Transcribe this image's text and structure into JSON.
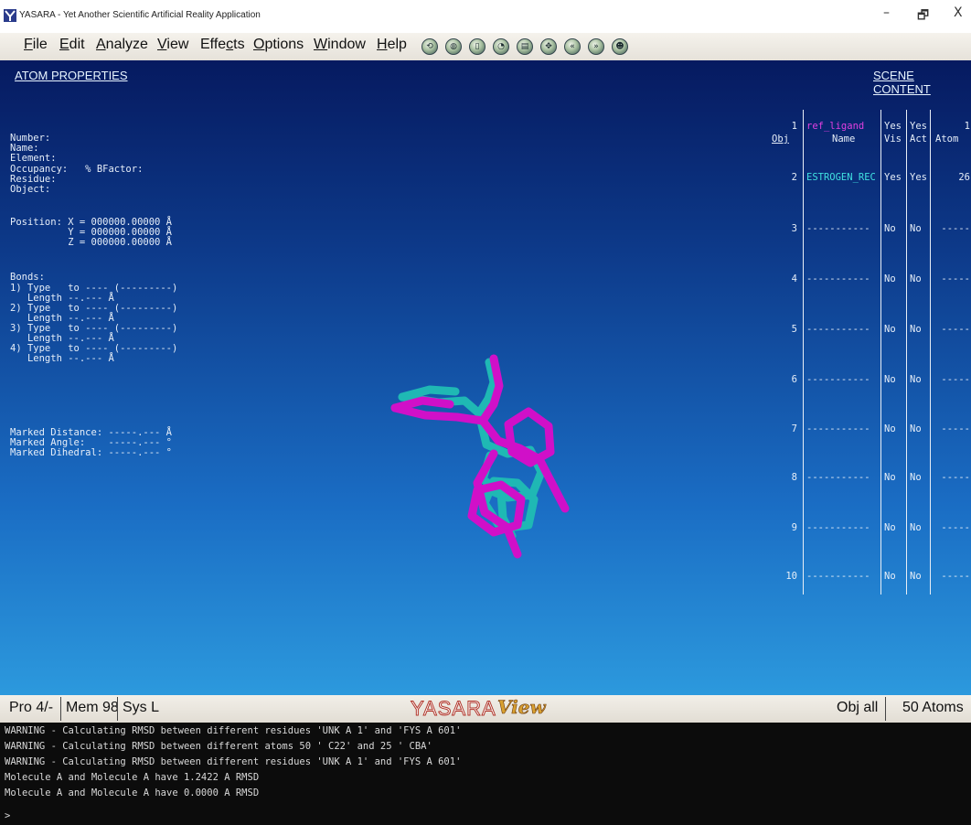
{
  "window": {
    "title": "YASARA - Yet Another Scientific Artificial Reality Application",
    "minimize": "–",
    "maximize": "🗗",
    "close": "X"
  },
  "menu": {
    "items": [
      "File",
      "Edit",
      "Analyze",
      "View",
      "Effects",
      "Options",
      "Window",
      "Help"
    ],
    "accelerators": [
      "F",
      "E",
      "A",
      "V",
      "c",
      "O",
      "W",
      "H"
    ],
    "toolbar_icons": [
      "reset-icon",
      "globe-icon",
      "page-icon",
      "gauge-icon",
      "lock-icon",
      "move-icon",
      "rewind-icon",
      "forward-icon",
      "user-icon"
    ]
  },
  "atom_properties": {
    "header": "ATOM PROPERTIES",
    "number_label": "Number:",
    "name_label": "Name:",
    "element_label": "Element:",
    "occupancy_label": "Occupancy:   % BFactor:",
    "residue_label": "Residue:",
    "object_label": "Object:",
    "position_x": "Position: X = 000000.00000 Å",
    "position_y": "          Y = 000000.00000 Å",
    "position_z": "          Z = 000000.00000 Å",
    "bonds_label": "Bonds:",
    "bonds": [
      {
        "type": "1) Type   to ---- (---------)",
        "length": "   Length --.--- Å"
      },
      {
        "type": "2) Type   to ---- (---------)",
        "length": "   Length --.--- Å"
      },
      {
        "type": "3) Type   to ---- (---------)",
        "length": "   Length --.--- Å"
      },
      {
        "type": "4) Type   to ---- (---------)",
        "length": "   Length --.--- Å"
      }
    ],
    "marked_distance": "Marked Distance: -----.--- Å",
    "marked_angle": "Marked Angle:    -----.--- °",
    "marked_dihedral": "Marked Dihedral: -----.--- °"
  },
  "scene_content": {
    "header": "SCENE CONTENT",
    "columns": [
      "Obj",
      "Name",
      "Vis",
      "Act",
      "Atom"
    ],
    "rows": [
      {
        "obj": "1",
        "name": "ref_ligand",
        "vis": "Yes",
        "act": "Yes",
        "atom": "1",
        "name_color": "#e040e0"
      },
      {
        "obj": "2",
        "name": "ESTROGEN_REC",
        "vis": "Yes",
        "act": "Yes",
        "atom": "26",
        "name_color": "#40e0e0"
      },
      {
        "obj": "3",
        "name": "-----------",
        "vis": "No",
        "act": "No",
        "atom": "-----",
        "name_color": "#e6eef8"
      },
      {
        "obj": "4",
        "name": "-----------",
        "vis": "No",
        "act": "No",
        "atom": "-----",
        "name_color": "#e6eef8"
      },
      {
        "obj": "5",
        "name": "-----------",
        "vis": "No",
        "act": "No",
        "atom": "-----",
        "name_color": "#e6eef8"
      },
      {
        "obj": "6",
        "name": "-----------",
        "vis": "No",
        "act": "No",
        "atom": "-----",
        "name_color": "#e6eef8"
      },
      {
        "obj": "7",
        "name": "-----------",
        "vis": "No",
        "act": "No",
        "atom": "-----",
        "name_color": "#e6eef8"
      },
      {
        "obj": "8",
        "name": "-----------",
        "vis": "No",
        "act": "No",
        "atom": "-----",
        "name_color": "#e6eef8"
      },
      {
        "obj": "9",
        "name": "-----------",
        "vis": "No",
        "act": "No",
        "atom": "-----",
        "name_color": "#e6eef8"
      },
      {
        "obj": "10",
        "name": "-----------",
        "vis": "No",
        "act": "No",
        "atom": "-----",
        "name_color": "#e6eef8"
      }
    ]
  },
  "statusbar": {
    "pro": "Pro 4/-",
    "mem": "Mem 98",
    "sys": "Sys L",
    "logo": "YASARA",
    "logo_sub": "View",
    "obj": "Obj all",
    "atoms": "50 Atoms"
  },
  "console": {
    "lines": [
      "WARNING - Calculating RMSD between different residues 'UNK A 1' and 'FYS A 601'",
      "WARNING - Calculating RMSD between different atoms 50 ' C22' and 25 ' CBA'",
      "WARNING - Calculating RMSD between different residues 'UNK A 1' and 'FYS A 601'",
      "Molecule A and Molecule A have 1.2422 A RMSD",
      "Molecule A and Molecule A have 0.0000 A RMSD",
      ">"
    ]
  },
  "colors": {
    "ref_ligand": "#d010c8",
    "estrogen_rec": "#1fb8b4"
  }
}
